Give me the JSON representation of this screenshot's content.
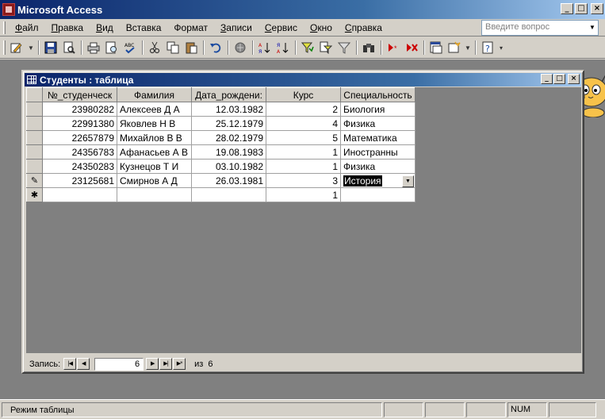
{
  "app": {
    "title": "Microsoft Access"
  },
  "menu": {
    "items": [
      {
        "label": "Файл",
        "u": "Ф",
        "rest": "айл"
      },
      {
        "label": "Правка",
        "u": "П",
        "rest": "равка"
      },
      {
        "label": "Вид",
        "u": "В",
        "rest": "ид"
      },
      {
        "label": "Вставка",
        "u": "",
        "rest": "Вставка"
      },
      {
        "label": "Формат",
        "u": "",
        "rest": "Формат"
      },
      {
        "label": "Записи",
        "u": "З",
        "rest": "аписи"
      },
      {
        "label": "Сервис",
        "u": "С",
        "rest": "ервис"
      },
      {
        "label": "Окно",
        "u": "О",
        "rest": "кно"
      },
      {
        "label": "Справка",
        "u": "С",
        "rest": "правка"
      }
    ],
    "ask_placeholder": "Введите вопрос"
  },
  "window": {
    "title": "Студенты : таблица"
  },
  "table": {
    "columns": [
      "№_студенческ",
      "Фамилия",
      "Дата_рождени:",
      "Курс",
      "Специальность"
    ],
    "rows": [
      [
        "23980282",
        "Алексеев Д А",
        "12.03.1982",
        "2",
        "Биология"
      ],
      [
        "22991380",
        "Яковлев Н В",
        "25.12.1979",
        "4",
        "Физика"
      ],
      [
        "22657879",
        "Михайлов В В",
        "28.02.1979",
        "5",
        "Математика"
      ],
      [
        "24356783",
        "Афанасьев А В",
        "19.08.1983",
        "1",
        "Иностранны"
      ],
      [
        "24350283",
        "Кузнецов Т И",
        "03.10.1982",
        "1",
        "Физика"
      ],
      [
        "23125681",
        "Смирнов А Д",
        "26.03.1981",
        "3",
        "История"
      ]
    ],
    "new_row": {
      "marker": "✱",
      "kurs": "1"
    },
    "edit_marker": "✎"
  },
  "nav": {
    "label": "Запись:",
    "current": "6",
    "of_label": "из",
    "total": "6"
  },
  "status": {
    "mode": "Режим таблицы",
    "num": "NUM"
  },
  "colors": {
    "title_start": "#0a246a",
    "title_end": "#a6caf0",
    "workspace": "#808080",
    "face": "#d4d0c8"
  }
}
